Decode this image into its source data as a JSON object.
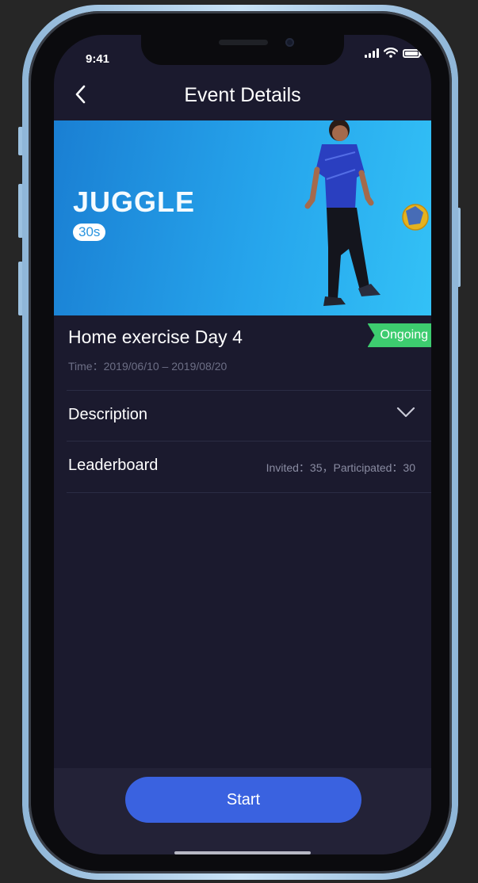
{
  "status_bar": {
    "time": "9:41"
  },
  "nav": {
    "title": "Event Details",
    "back_icon": "chevron-left-icon"
  },
  "banner": {
    "title": "JUGGLE",
    "badge": "30s",
    "gradient": [
      "#1a7fd3",
      "#33c1f6"
    ]
  },
  "event": {
    "name": "Home exercise Day 4",
    "status": "Ongoing",
    "status_color": "#3dcc6f",
    "time_text": "Time：2019/06/10 – 2019/08/20"
  },
  "sections": [
    {
      "label": "Description",
      "icon": "chevron-down-icon"
    },
    {
      "label": "Leaderboard",
      "meta": "Invited：35，Participated：30"
    }
  ],
  "footer": {
    "start_label": "Start",
    "accent": "#3a62e0"
  }
}
